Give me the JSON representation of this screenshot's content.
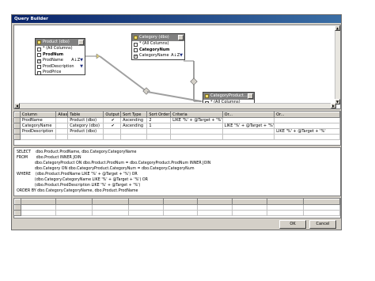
{
  "window": {
    "title": "Query Builder"
  },
  "tables": {
    "product": {
      "title": "Product (dbo)",
      "rows": [
        {
          "label": "* (All Columns)",
          "checked": false,
          "bold": false
        },
        {
          "label": "ProdNum",
          "checked": false,
          "bold": true
        },
        {
          "label": "ProdName",
          "checked": true,
          "bold": false,
          "sort": "A↓Z",
          "filter": "▼"
        },
        {
          "label": "ProdDescription",
          "checked": false,
          "bold": false,
          "filter": "▼"
        },
        {
          "label": "ProdPrice",
          "checked": false,
          "bold": false
        }
      ]
    },
    "category": {
      "title": "Category (dbo)",
      "rows": [
        {
          "label": "* (All Columns)",
          "checked": false,
          "bold": false
        },
        {
          "label": "CategoryNum",
          "checked": false,
          "bold": true
        },
        {
          "label": "CategoryName",
          "checked": true,
          "bold": false,
          "sort": "A↓Z",
          "filter": "▼"
        }
      ]
    },
    "category_product": {
      "title": "CategoryProduct...",
      "rows": [
        {
          "label": "* (All Columns)",
          "checked": false,
          "bold": false
        }
      ]
    }
  },
  "grid": {
    "headers": [
      "Column",
      "Alias",
      "Table",
      "Output",
      "Sort Type",
      "Sort Order",
      "Criteria",
      "Or...",
      "Or..."
    ],
    "rows": [
      [
        "ProdName",
        "",
        "Product (dbo)",
        "✔",
        "Ascending",
        "2",
        "LIKE '%' + @Target + '%'",
        "",
        ""
      ],
      [
        "CategoryName",
        "",
        "Category (dbo)",
        "✔",
        "Ascending",
        "1",
        "",
        "LIKE '%' + @Target + '%'",
        ""
      ],
      [
        "ProdDescription",
        "",
        "Product (dbo)",
        "",
        "",
        "",
        "",
        "",
        "LIKE '%' + @Target + '%'"
      ],
      [
        "",
        "",
        "",
        "",
        "",
        "",
        "",
        "",
        ""
      ]
    ]
  },
  "sql": [
    "SELECT    dbo.Product.ProdName, dbo.Category.CategoryName",
    "FROM       dbo.Product INNER JOIN",
    "               dbo.CategoryProduct ON dbo.Product.ProdNum = dbo.CategoryProduct.ProdNum INNER JOIN",
    "               dbo.Category ON dbo.CategoryProduct.CategoryNum = dbo.Category.CategoryNum",
    "WHERE    (dbo.Product.ProdName LIKE '%' + @Target + '%') OR",
    "               (dbo.Category.CategoryName LIKE '%' + @Target + '%') OR",
    "               (dbo.Product.ProdDescription LIKE '%' + @Target + '%')",
    "ORDER BY dbo.Category.CategoryName, dbo.Product.ProdName"
  ],
  "buttons": {
    "ok": "OK",
    "cancel": "Cancel"
  }
}
